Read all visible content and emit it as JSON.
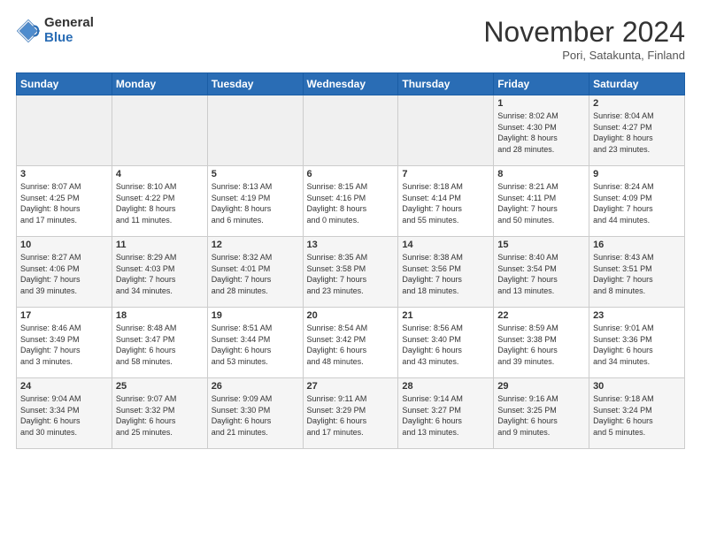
{
  "logo": {
    "general": "General",
    "blue": "Blue"
  },
  "title": "November 2024",
  "location": "Pori, Satakunta, Finland",
  "weekdays": [
    "Sunday",
    "Monday",
    "Tuesday",
    "Wednesday",
    "Thursday",
    "Friday",
    "Saturday"
  ],
  "weeks": [
    [
      {
        "day": "",
        "detail": ""
      },
      {
        "day": "",
        "detail": ""
      },
      {
        "day": "",
        "detail": ""
      },
      {
        "day": "",
        "detail": ""
      },
      {
        "day": "",
        "detail": ""
      },
      {
        "day": "1",
        "detail": "Sunrise: 8:02 AM\nSunset: 4:30 PM\nDaylight: 8 hours\nand 28 minutes."
      },
      {
        "day": "2",
        "detail": "Sunrise: 8:04 AM\nSunset: 4:27 PM\nDaylight: 8 hours\nand 23 minutes."
      }
    ],
    [
      {
        "day": "3",
        "detail": "Sunrise: 8:07 AM\nSunset: 4:25 PM\nDaylight: 8 hours\nand 17 minutes."
      },
      {
        "day": "4",
        "detail": "Sunrise: 8:10 AM\nSunset: 4:22 PM\nDaylight: 8 hours\nand 11 minutes."
      },
      {
        "day": "5",
        "detail": "Sunrise: 8:13 AM\nSunset: 4:19 PM\nDaylight: 8 hours\nand 6 minutes."
      },
      {
        "day": "6",
        "detail": "Sunrise: 8:15 AM\nSunset: 4:16 PM\nDaylight: 8 hours\nand 0 minutes."
      },
      {
        "day": "7",
        "detail": "Sunrise: 8:18 AM\nSunset: 4:14 PM\nDaylight: 7 hours\nand 55 minutes."
      },
      {
        "day": "8",
        "detail": "Sunrise: 8:21 AM\nSunset: 4:11 PM\nDaylight: 7 hours\nand 50 minutes."
      },
      {
        "day": "9",
        "detail": "Sunrise: 8:24 AM\nSunset: 4:09 PM\nDaylight: 7 hours\nand 44 minutes."
      }
    ],
    [
      {
        "day": "10",
        "detail": "Sunrise: 8:27 AM\nSunset: 4:06 PM\nDaylight: 7 hours\nand 39 minutes."
      },
      {
        "day": "11",
        "detail": "Sunrise: 8:29 AM\nSunset: 4:03 PM\nDaylight: 7 hours\nand 34 minutes."
      },
      {
        "day": "12",
        "detail": "Sunrise: 8:32 AM\nSunset: 4:01 PM\nDaylight: 7 hours\nand 28 minutes."
      },
      {
        "day": "13",
        "detail": "Sunrise: 8:35 AM\nSunset: 3:58 PM\nDaylight: 7 hours\nand 23 minutes."
      },
      {
        "day": "14",
        "detail": "Sunrise: 8:38 AM\nSunset: 3:56 PM\nDaylight: 7 hours\nand 18 minutes."
      },
      {
        "day": "15",
        "detail": "Sunrise: 8:40 AM\nSunset: 3:54 PM\nDaylight: 7 hours\nand 13 minutes."
      },
      {
        "day": "16",
        "detail": "Sunrise: 8:43 AM\nSunset: 3:51 PM\nDaylight: 7 hours\nand 8 minutes."
      }
    ],
    [
      {
        "day": "17",
        "detail": "Sunrise: 8:46 AM\nSunset: 3:49 PM\nDaylight: 7 hours\nand 3 minutes."
      },
      {
        "day": "18",
        "detail": "Sunrise: 8:48 AM\nSunset: 3:47 PM\nDaylight: 6 hours\nand 58 minutes."
      },
      {
        "day": "19",
        "detail": "Sunrise: 8:51 AM\nSunset: 3:44 PM\nDaylight: 6 hours\nand 53 minutes."
      },
      {
        "day": "20",
        "detail": "Sunrise: 8:54 AM\nSunset: 3:42 PM\nDaylight: 6 hours\nand 48 minutes."
      },
      {
        "day": "21",
        "detail": "Sunrise: 8:56 AM\nSunset: 3:40 PM\nDaylight: 6 hours\nand 43 minutes."
      },
      {
        "day": "22",
        "detail": "Sunrise: 8:59 AM\nSunset: 3:38 PM\nDaylight: 6 hours\nand 39 minutes."
      },
      {
        "day": "23",
        "detail": "Sunrise: 9:01 AM\nSunset: 3:36 PM\nDaylight: 6 hours\nand 34 minutes."
      }
    ],
    [
      {
        "day": "24",
        "detail": "Sunrise: 9:04 AM\nSunset: 3:34 PM\nDaylight: 6 hours\nand 30 minutes."
      },
      {
        "day": "25",
        "detail": "Sunrise: 9:07 AM\nSunset: 3:32 PM\nDaylight: 6 hours\nand 25 minutes."
      },
      {
        "day": "26",
        "detail": "Sunrise: 9:09 AM\nSunset: 3:30 PM\nDaylight: 6 hours\nand 21 minutes."
      },
      {
        "day": "27",
        "detail": "Sunrise: 9:11 AM\nSunset: 3:29 PM\nDaylight: 6 hours\nand 17 minutes."
      },
      {
        "day": "28",
        "detail": "Sunrise: 9:14 AM\nSunset: 3:27 PM\nDaylight: 6 hours\nand 13 minutes."
      },
      {
        "day": "29",
        "detail": "Sunrise: 9:16 AM\nSunset: 3:25 PM\nDaylight: 6 hours\nand 9 minutes."
      },
      {
        "day": "30",
        "detail": "Sunrise: 9:18 AM\nSunset: 3:24 PM\nDaylight: 6 hours\nand 5 minutes."
      }
    ]
  ]
}
